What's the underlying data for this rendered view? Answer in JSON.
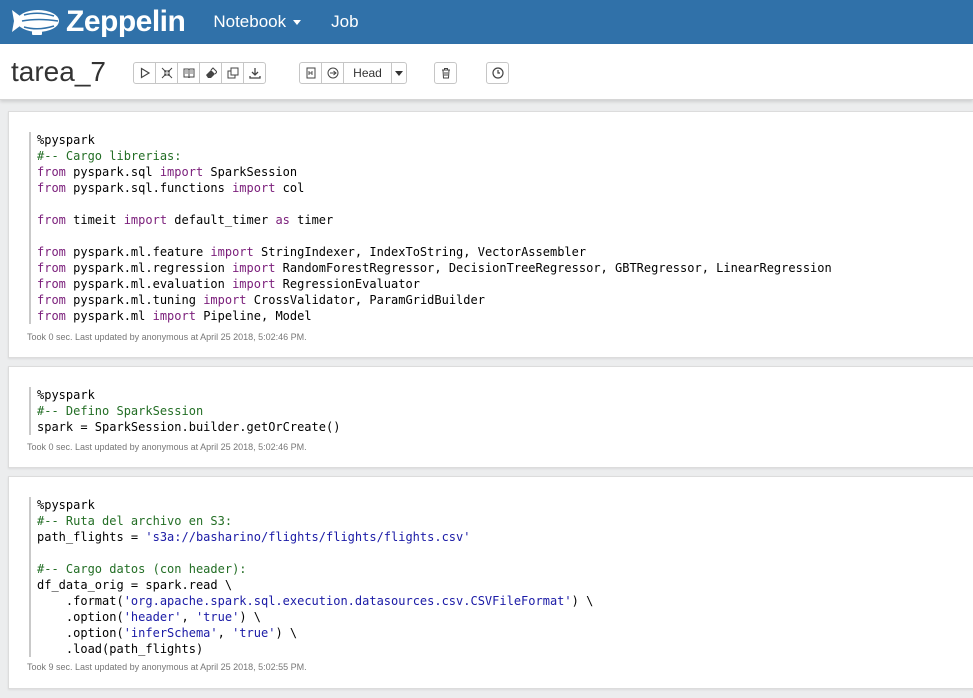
{
  "navbar": {
    "brand": "Zeppelin",
    "notebook_label": "Notebook",
    "job_label": "Job",
    "color": "#3071a9"
  },
  "notebook": {
    "title": "tarea_7",
    "head_label": "Head",
    "toolbar_icons": [
      "play-icon",
      "hide-code-icon",
      "book-icon",
      "eraser-icon",
      "clone-icon",
      "download-icon",
      "version-control-icon",
      "commit-icon",
      "trash-icon",
      "clock-icon"
    ]
  },
  "paragraphs": [
    {
      "lines": [
        [
          [
            "",
            "%pyspark"
          ]
        ],
        [
          [
            "cm",
            "#-- Cargo librerias:"
          ]
        ],
        [
          [
            "kw",
            "from"
          ],
          [
            "",
            " pyspark.sql "
          ],
          [
            "kw",
            "import"
          ],
          [
            "",
            " SparkSession"
          ]
        ],
        [
          [
            "kw",
            "from"
          ],
          [
            "",
            " pyspark.sql.functions "
          ],
          [
            "kw",
            "import"
          ],
          [
            "",
            " col"
          ]
        ],
        [
          [
            "",
            ""
          ]
        ],
        [
          [
            "kw",
            "from"
          ],
          [
            "",
            " timeit "
          ],
          [
            "kw",
            "import"
          ],
          [
            "",
            " default_timer "
          ],
          [
            "kw",
            "as"
          ],
          [
            "",
            " timer"
          ]
        ],
        [
          [
            "",
            ""
          ]
        ],
        [
          [
            "kw",
            "from"
          ],
          [
            "",
            " pyspark.ml.feature "
          ],
          [
            "kw",
            "import"
          ],
          [
            "",
            " StringIndexer, IndexToString, VectorAssembler"
          ]
        ],
        [
          [
            "kw",
            "from"
          ],
          [
            "",
            " pyspark.ml.regression "
          ],
          [
            "kw",
            "import"
          ],
          [
            "",
            " RandomForestRegressor, DecisionTreeRegressor, GBTRegressor, LinearRegression"
          ]
        ],
        [
          [
            "kw",
            "from"
          ],
          [
            "",
            " pyspark.ml.evaluation "
          ],
          [
            "kw",
            "import"
          ],
          [
            "",
            " RegressionEvaluator"
          ]
        ],
        [
          [
            "kw",
            "from"
          ],
          [
            "",
            " pyspark.ml.tuning "
          ],
          [
            "kw",
            "import"
          ],
          [
            "",
            " CrossValidator, ParamGridBuilder"
          ]
        ],
        [
          [
            "kw",
            "from"
          ],
          [
            "",
            " pyspark.ml "
          ],
          [
            "kw",
            "import"
          ],
          [
            "",
            " Pipeline, Model"
          ]
        ]
      ],
      "footer": "Took 0 sec. Last updated by anonymous at April 25 2018, 5:02:46 PM."
    },
    {
      "lines": [
        [
          [
            "",
            "%pyspark"
          ]
        ],
        [
          [
            "cm",
            "#-- Defino SparkSession"
          ]
        ],
        [
          [
            "",
            "spark = SparkSession.builder.getOrCreate()"
          ]
        ]
      ],
      "footer": "Took 0 sec. Last updated by anonymous at April 25 2018, 5:02:46 PM."
    },
    {
      "lines": [
        [
          [
            "",
            "%pyspark"
          ]
        ],
        [
          [
            "cm",
            "#-- Ruta del archivo en S3:"
          ]
        ],
        [
          [
            "",
            "path_flights = "
          ],
          [
            "st",
            "'s3a://basharino/flights/flights/flights.csv'"
          ]
        ],
        [
          [
            "",
            ""
          ]
        ],
        [
          [
            "cm",
            "#-- Cargo datos (con header):"
          ]
        ],
        [
          [
            "",
            "df_data_orig = spark.read \\"
          ]
        ],
        [
          [
            "",
            "    .format("
          ],
          [
            "st",
            "'org.apache.spark.sql.execution.datasources.csv.CSVFileFormat'"
          ],
          [
            "",
            ") \\"
          ]
        ],
        [
          [
            "",
            "    .option("
          ],
          [
            "st",
            "'header'"
          ],
          [
            "",
            ", "
          ],
          [
            "st",
            "'true'"
          ],
          [
            "",
            ") \\"
          ]
        ],
        [
          [
            "",
            "    .option("
          ],
          [
            "st",
            "'inferSchema'"
          ],
          [
            "",
            ", "
          ],
          [
            "st",
            "'true'"
          ],
          [
            "",
            ") \\"
          ]
        ],
        [
          [
            "",
            "    .load(path_flights)"
          ]
        ]
      ],
      "footer": "Took 9 sec. Last updated by anonymous at April 25 2018, 5:02:55 PM."
    }
  ]
}
